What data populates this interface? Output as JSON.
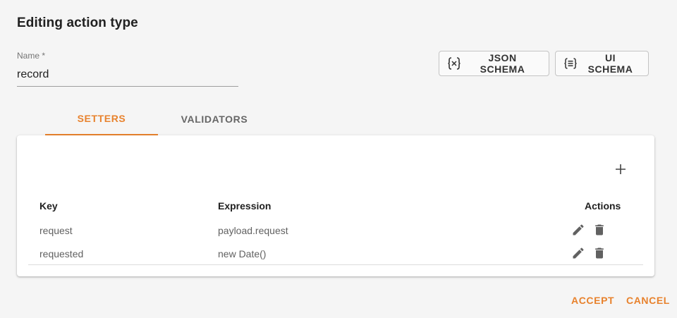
{
  "dialog": {
    "title": "Editing action type"
  },
  "name_field": {
    "label": "Name *",
    "value": "record"
  },
  "schema_buttons": {
    "json_label": "JSON SCHEMA",
    "ui_label": "UI SCHEMA"
  },
  "tabs": [
    {
      "label": "SETTERS",
      "active": true
    },
    {
      "label": "VALIDATORS",
      "active": false
    }
  ],
  "table": {
    "headers": {
      "key": "Key",
      "expression": "Expression",
      "actions": "Actions"
    },
    "rows": [
      {
        "key": "request",
        "expression": "payload.request"
      },
      {
        "key": "requested",
        "expression": "new Date()"
      }
    ]
  },
  "footer": {
    "accept_label": "ACCEPT",
    "cancel_label": "CANCEL"
  },
  "colors": {
    "accent": "#e8822d",
    "text": "#212121",
    "muted": "#616161",
    "icon": "#616161"
  },
  "icons": {
    "add": "plus-icon",
    "edit": "pencil-icon",
    "delete": "trash-icon",
    "json_schema": "braces-icon",
    "ui_schema": "list-braces-icon"
  }
}
